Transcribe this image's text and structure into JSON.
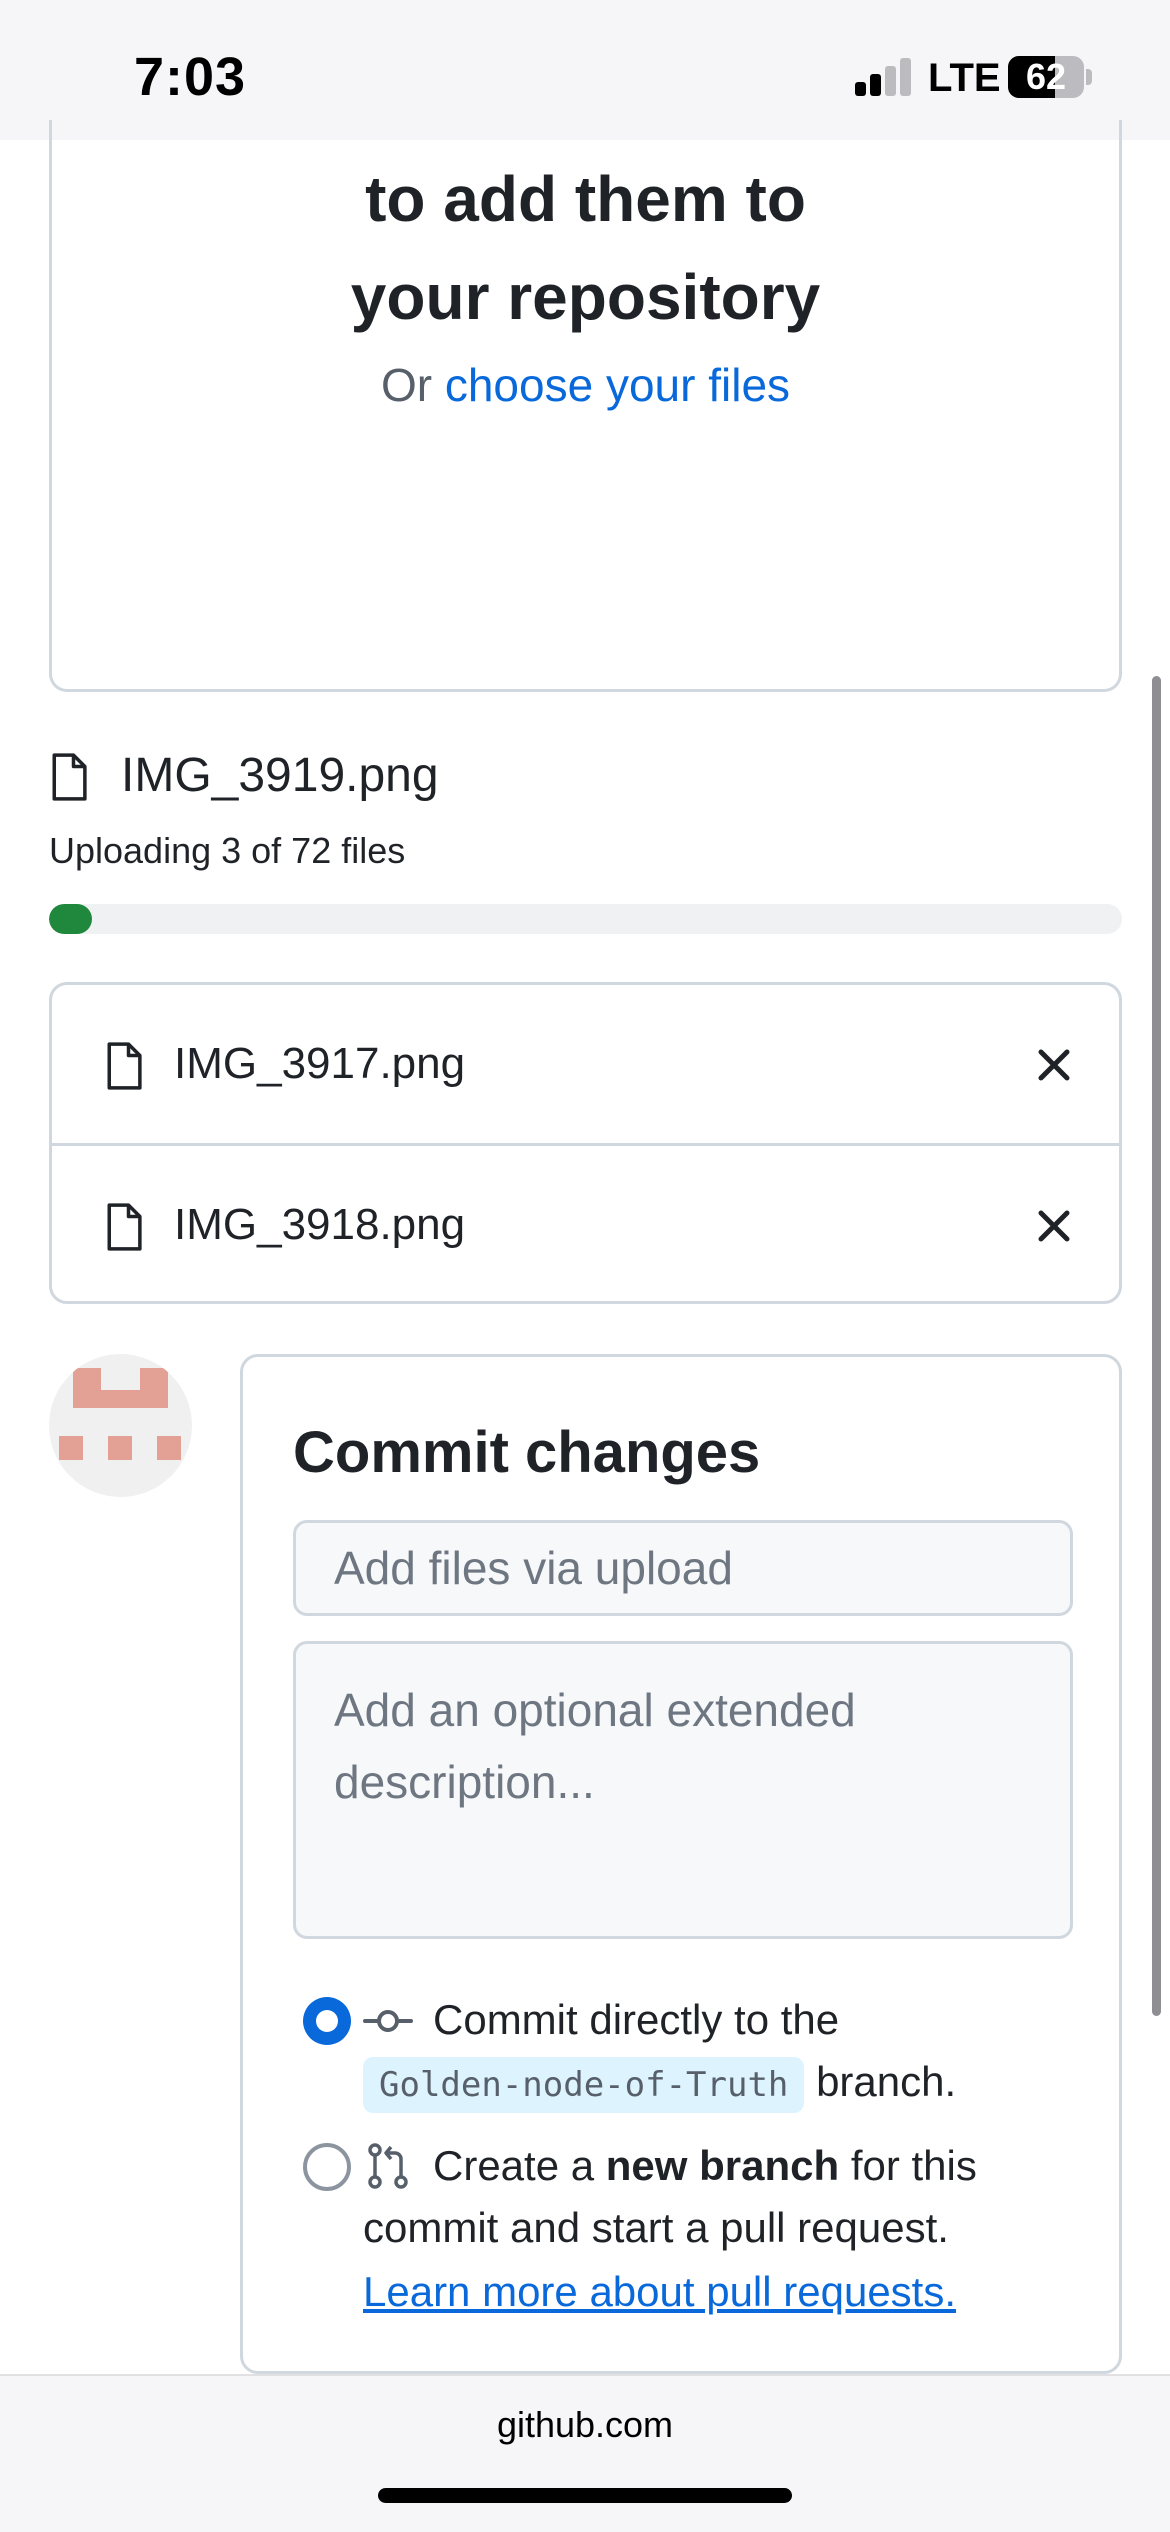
{
  "status_bar": {
    "time": "7:03",
    "network": "LTE",
    "battery": "62"
  },
  "dropzone": {
    "title": "to add them to your repository",
    "or_text": "Or ",
    "choose_link": "choose your files"
  },
  "upload": {
    "current_file": "IMG_3919.png",
    "status": "Uploading 3 of 72 files",
    "progress_fraction": 0.04
  },
  "files": [
    {
      "name": "IMG_3917.png"
    },
    {
      "name": "IMG_3918.png"
    }
  ],
  "commit": {
    "title": "Commit changes",
    "summary_placeholder": "Add files via upload",
    "description_placeholder": "Add an optional extended description...",
    "option_direct": {
      "text": "Commit directly to the",
      "branch": "Golden-node-of-Truth",
      "suffix": "branch."
    },
    "option_new_branch": {
      "prefix": "Create a ",
      "bold": "new branch",
      "suffix": " for this",
      "line2": "commit and start a pull request.",
      "link": "Learn more about pull requests."
    }
  },
  "browser": {
    "url": "github.com"
  },
  "colors": {
    "accent": "#0969da",
    "progress": "#1f883d",
    "border": "#d0d7de",
    "avatar": "#e3a196"
  }
}
